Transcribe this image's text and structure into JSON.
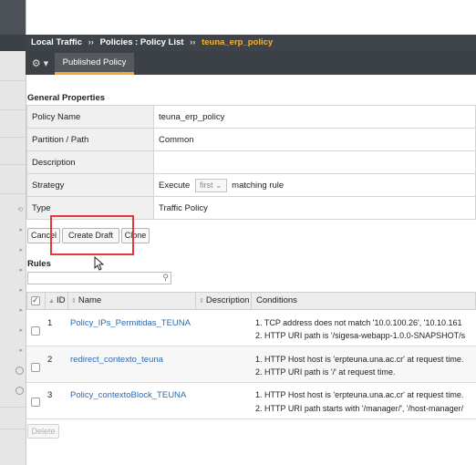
{
  "breadcrumb": {
    "part1": "Local Traffic",
    "part2": "Policies : Policy List",
    "current": "teuna_erp_policy",
    "separator": "››"
  },
  "tabs": {
    "gear": "⚙ ▾",
    "published": "Published Policy"
  },
  "general": {
    "title": "General Properties",
    "rows": [
      {
        "label": "Policy Name",
        "value": "teuna_erp_policy"
      },
      {
        "label": "Partition / Path",
        "value": "Common"
      },
      {
        "label": "Description",
        "value": ""
      },
      {
        "label": "Strategy",
        "prefix": "Execute",
        "select": "first",
        "suffix": "matching rule"
      },
      {
        "label": "Type",
        "value": "Traffic Policy"
      }
    ]
  },
  "buttons": {
    "cancel": "Cancel",
    "create_draft": "Create Draft",
    "clone": "Clone",
    "delete": "Delete"
  },
  "rules": {
    "title": "Rules",
    "search_placeholder": "",
    "columns": {
      "id": "ID",
      "name": "Name",
      "description": "Description",
      "conditions": "Conditions"
    },
    "rows": [
      {
        "id": "1",
        "name": "Policy_IPs_Permitidas_TEUNA",
        "cond1": "1. TCP address does not match '10.0.100.26', '10.10.161",
        "cond2": "2. HTTP URI path is '/sigesa-webapp-1.0.0-SNAPSHOT/s"
      },
      {
        "id": "2",
        "name": "redirect_contexto_teuna",
        "cond1": "1. HTTP Host host is 'erpteuna.una.ac.cr' at request time.",
        "cond2": "2. HTTP URI path is '/' at request time."
      },
      {
        "id": "3",
        "name": "Policy_contextoBlock_TEUNA",
        "cond1": "1. HTTP Host host is 'erpteuna.una.ac.cr' at request time.",
        "cond2": "2. HTTP URI path starts with '/manager/', '/host-manager/"
      }
    ]
  },
  "colors": {
    "accent": "#f0a830",
    "link": "#2c6ab0",
    "highlight": "#e0393e",
    "topbar": "#3e4449"
  }
}
